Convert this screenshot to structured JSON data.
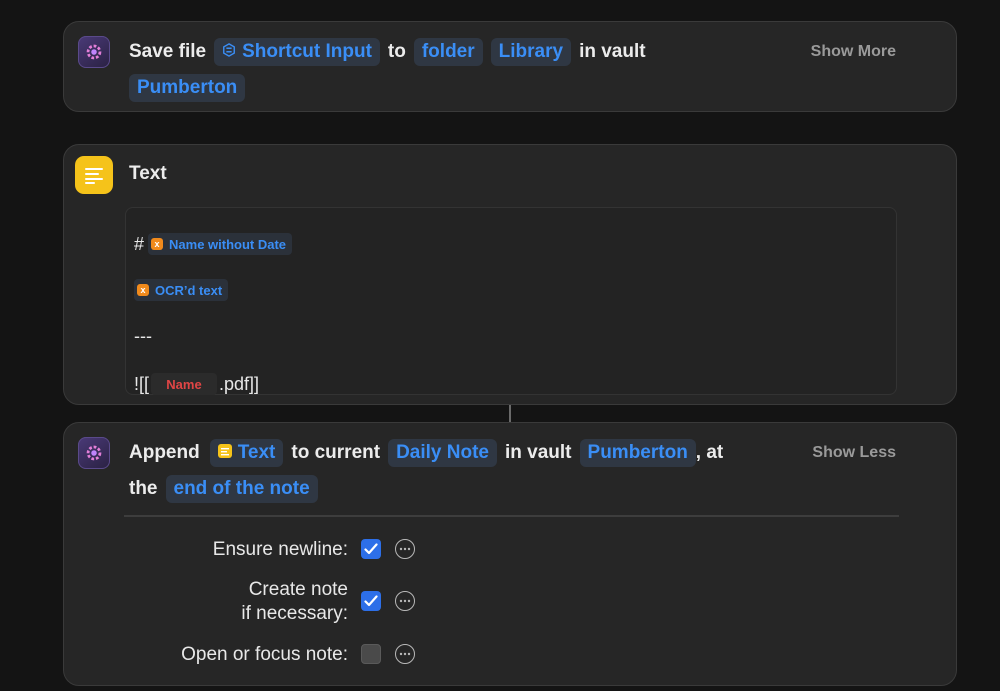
{
  "save_action": {
    "verb": "Save file",
    "input_token": "Shortcut Input",
    "to": "to",
    "folder_token": "folder",
    "library_token": "Library",
    "in_vault": "in vault",
    "vault_token": "Pumberton",
    "show_more": "Show More"
  },
  "text_action": {
    "title": "Text",
    "lines": {
      "heading_hash": "#",
      "name_without_date": "Name without Date",
      "ocr_text": "OCR’d text",
      "separator": "---",
      "embed_prefix": "![[",
      "name_token": "Name",
      "embed_suffix": ".pdf]]"
    }
  },
  "append_action": {
    "verb": "Append",
    "text_token": "Text",
    "to_current": "to current",
    "daily_note_token": "Daily Note",
    "in_vault": "in vault",
    "vault_token": "Pumberton",
    "comma_at": ", at",
    "the": "the",
    "position_token": "end of the note",
    "show_less": "Show Less",
    "params": [
      {
        "label": "Ensure newline:",
        "checked": true
      },
      {
        "label_line1": "Create note",
        "label_line2": "if necessary:",
        "checked": true
      },
      {
        "label": "Open or focus note:",
        "checked": false
      }
    ]
  },
  "colors": {
    "token_blue": "#3a8ef6",
    "checkbox_blue": "#2d6fe8",
    "variable_orange": "#f08a1c",
    "text_icon_yellow": "#f5c31a",
    "name_red": "#e04545"
  },
  "icons": {
    "obsidian": "obsidian-gear-icon",
    "text": "text-lines-icon",
    "more": "ellipsis-circle-icon"
  }
}
